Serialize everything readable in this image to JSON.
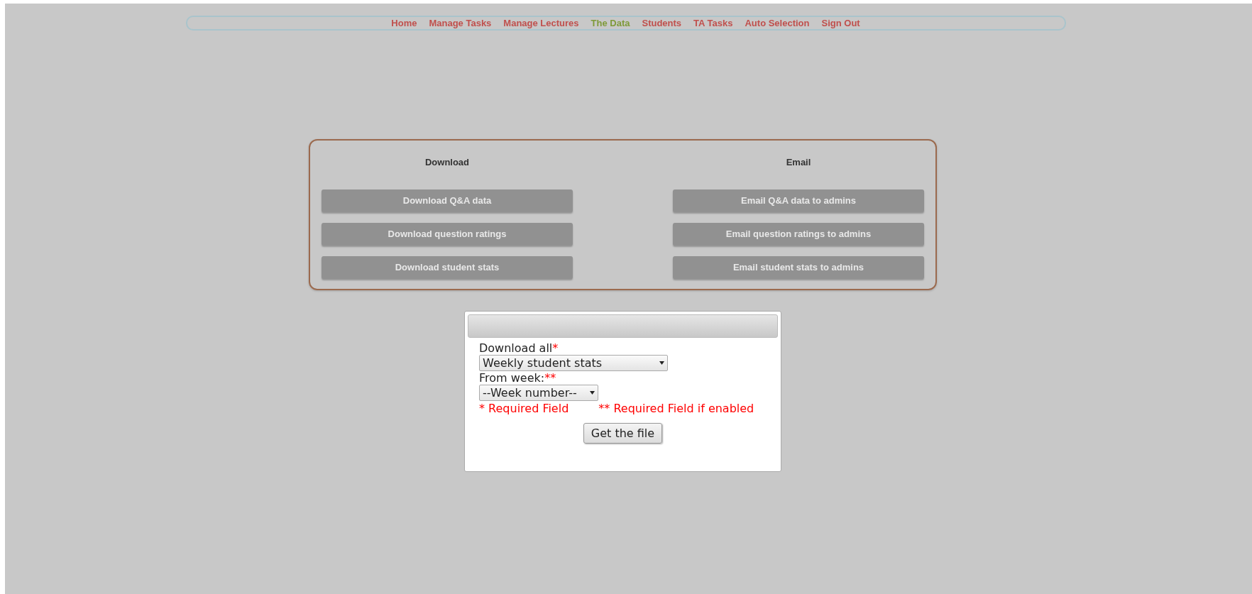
{
  "nav": [
    {
      "label": "Home",
      "selected": false
    },
    {
      "label": "Manage Tasks",
      "selected": false
    },
    {
      "label": "Manage Lectures",
      "selected": false
    },
    {
      "label": "The Data",
      "selected": true
    },
    {
      "label": "Students",
      "selected": false
    },
    {
      "label": "TA Tasks",
      "selected": false
    },
    {
      "label": "Auto Selection",
      "selected": false
    },
    {
      "label": "Sign Out",
      "selected": false
    }
  ],
  "panel": {
    "columns": [
      {
        "heading": "Download",
        "buttons": [
          "Download Q&A data",
          "Download question ratings",
          "Download student stats"
        ]
      },
      {
        "heading": "Email",
        "buttons": [
          "Email Q&A data to admins",
          "Email question ratings to admins",
          "Email student stats to admins"
        ]
      }
    ]
  },
  "form": {
    "fields": [
      {
        "label": "Download all",
        "required_mark": "*",
        "value": "Weekly student stats",
        "kind": "wide"
      },
      {
        "label": "From week:",
        "required_mark": "**",
        "value": "--Week number--",
        "kind": "narrow"
      }
    ],
    "notes": [
      "* Required Field",
      "** Required Field if enabled"
    ],
    "submit": "Get the file"
  }
}
